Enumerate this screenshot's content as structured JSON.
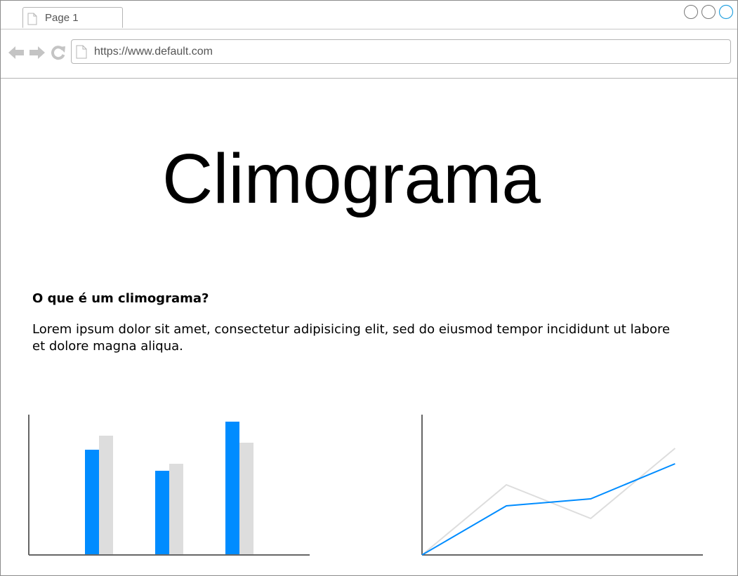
{
  "browser": {
    "tab": {
      "label": "Page 1"
    },
    "address_bar": {
      "url": "https://www.default.com"
    }
  },
  "page": {
    "title": "Climograma",
    "section": {
      "heading": "O que é um climograma?",
      "body": "Lorem ipsum dolor sit amet, consectetur adipisicing elit, sed do eiusmod tempor incididunt ut labore et dolore magna aliqua."
    }
  },
  "colors": {
    "accent": "#008cff",
    "secondary": "#dddddd",
    "axis": "#666666",
    "icon_gray": "#c4c4c4",
    "control_blue": "#29a3e0"
  },
  "icons": {
    "tab": "page-icon",
    "back": "arrow-left-icon",
    "forward": "arrow-right-icon",
    "reload": "reload-icon",
    "url": "page-icon",
    "window_controls": [
      "circle-icon",
      "circle-icon",
      "circle-icon"
    ]
  },
  "chart_data": [
    {
      "type": "bar",
      "categories": [
        "",
        "",
        ""
      ],
      "ylim": [
        0,
        100
      ],
      "series": [
        {
          "values": [
            75,
            60,
            95
          ],
          "color": "#008cff"
        },
        {
          "values": [
            85,
            65,
            80
          ],
          "color": "#dddddd"
        }
      ],
      "grid": false
    },
    {
      "type": "line",
      "x": [
        0,
        1,
        2,
        3
      ],
      "xlim": [
        0,
        3.33
      ],
      "ylim": [
        0,
        100
      ],
      "series": [
        {
          "values": [
            0,
            35,
            40,
            65
          ],
          "color": "#008cff"
        },
        {
          "values": [
            0,
            50,
            26,
            76
          ],
          "color": "#dddddd"
        }
      ],
      "grid": false
    }
  ]
}
